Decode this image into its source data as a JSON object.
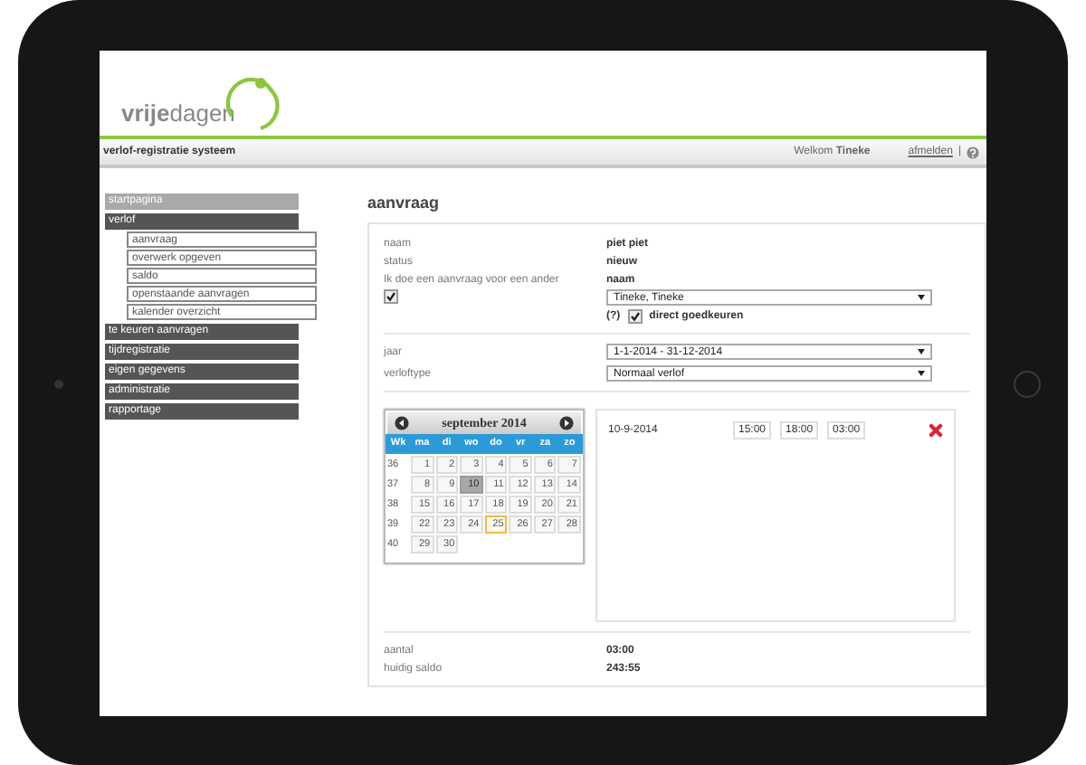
{
  "logo": {
    "text": "**vrije**dagen"
  },
  "topbar": {
    "title": "verlof-registratie systeem",
    "welcome": "Welkom **Tineke**",
    "logout": "afmelden",
    "separator": "|"
  },
  "sidebar": {
    "items": [
      {
        "label": "startpagina",
        "kind": "link"
      },
      {
        "label": "verlof",
        "kind": "section",
        "children": [
          {
            "label": "aanvraag"
          },
          {
            "label": "overwerk opgeven"
          },
          {
            "label": "saldo"
          },
          {
            "label": "openstaande aanvragen"
          },
          {
            "label": "kalender overzicht"
          }
        ]
      },
      {
        "label": "te keuren aanvragen",
        "kind": "section"
      },
      {
        "label": "tijdregistratie",
        "kind": "section"
      },
      {
        "label": "eigen gegevens",
        "kind": "section"
      },
      {
        "label": "administratie",
        "kind": "section"
      },
      {
        "label": "rapportage",
        "kind": "section"
      }
    ]
  },
  "page": {
    "title": "aanvraag"
  },
  "fields": [
    {
      "label": "naam",
      "value": "piet piet"
    },
    {
      "label": "status",
      "value": "nieuw"
    }
  ],
  "for_other": {
    "label": "Ik doe een aanvraag voor een ander",
    "checked": true,
    "name_label": "naam",
    "name_select": "Tineke, Tineke",
    "help": "(?)",
    "approve_label": "direct goedkeuren",
    "approve_checked": true
  },
  "selects": [
    {
      "label": "jaar",
      "value": "1-1-2014 - 31-12-2014"
    },
    {
      "label": "verloftype",
      "value": "Normaal verlof"
    }
  ],
  "calendar": {
    "month": "september 2014",
    "weekdays": [
      "Wk",
      "ma",
      "di",
      "wo",
      "do",
      "vr",
      "za",
      "zo"
    ],
    "weeks": [
      {
        "number": "36",
        "days": [
          {
            "day": "1",
            "selected": false,
            "highlighted": false
          },
          {
            "day": "2",
            "selected": false,
            "highlighted": false
          },
          {
            "day": "3",
            "selected": false,
            "highlighted": false
          },
          {
            "day": "4",
            "selected": false,
            "highlighted": false
          },
          {
            "day": "5",
            "selected": false,
            "highlighted": false
          },
          {
            "day": "6",
            "selected": false,
            "highlighted": false
          },
          {
            "day": "7",
            "selected": false,
            "highlighted": false
          }
        ]
      },
      {
        "number": "37",
        "days": [
          {
            "day": "8",
            "selected": false,
            "highlighted": false
          },
          {
            "day": "9",
            "selected": false,
            "highlighted": false
          },
          {
            "day": "10",
            "selected": true,
            "highlighted": false
          },
          {
            "day": "11",
            "selected": false,
            "highlighted": false
          },
          {
            "day": "12",
            "selected": false,
            "highlighted": false
          },
          {
            "day": "13",
            "selected": false,
            "highlighted": false
          },
          {
            "day": "14",
            "selected": false,
            "highlighted": false
          }
        ]
      },
      {
        "number": "38",
        "days": [
          {
            "day": "15",
            "selected": false,
            "highlighted": false
          },
          {
            "day": "16",
            "selected": false,
            "highlighted": false
          },
          {
            "day": "17",
            "selected": false,
            "highlighted": false
          },
          {
            "day": "18",
            "selected": false,
            "highlighted": false
          },
          {
            "day": "19",
            "selected": false,
            "highlighted": false
          },
          {
            "day": "20",
            "selected": false,
            "highlighted": false
          },
          {
            "day": "21",
            "selected": false,
            "highlighted": false
          }
        ]
      },
      {
        "number": "39",
        "days": [
          {
            "day": "22",
            "selected": false,
            "highlighted": false
          },
          {
            "day": "23",
            "selected": false,
            "highlighted": false
          },
          {
            "day": "24",
            "selected": false,
            "highlighted": false
          },
          {
            "day": "25",
            "selected": false,
            "highlighted": true
          },
          {
            "day": "26",
            "selected": false,
            "highlighted": false
          },
          {
            "day": "27",
            "selected": false,
            "highlighted": false
          },
          {
            "day": "28",
            "selected": false,
            "highlighted": false
          }
        ]
      },
      {
        "number": "40",
        "days": [
          {
            "day": "29",
            "selected": false,
            "highlighted": false
          },
          {
            "day": "30",
            "selected": false,
            "highlighted": false
          }
        ]
      }
    ]
  },
  "entries": [
    {
      "date": "10-9-2014",
      "start": "15:00",
      "end": "18:00",
      "duration": "03:00"
    }
  ],
  "totals": [
    {
      "label": "aantal",
      "value": "03:00"
    },
    {
      "label": "huidig saldo",
      "value": "243:55"
    }
  ]
}
